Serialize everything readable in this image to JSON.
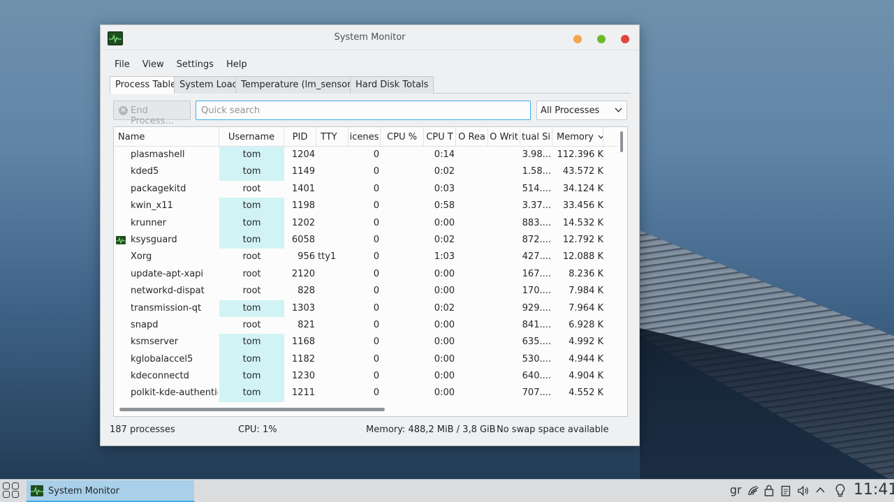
{
  "window": {
    "title": "System Monitor",
    "icon": "system-monitor-icon"
  },
  "menu": [
    "File",
    "View",
    "Settings",
    "Help"
  ],
  "tabs": [
    "Process Table",
    "System Load",
    "Temperature (lm_sensors)",
    "Hard Disk Totals"
  ],
  "active_tab": "Process Table",
  "toolbar": {
    "end_process_label": "End Process...",
    "search_placeholder": "Quick search",
    "filter_value": "All Processes"
  },
  "table": {
    "columns": [
      "Name",
      "Username",
      "PID",
      "TTY",
      "icenes",
      "CPU %",
      "CPU T",
      "O Rea",
      "O Writ",
      "tual Si",
      "Memory"
    ],
    "sort_column": "Memory",
    "rows": [
      {
        "name": "plasmashell",
        "user": "tom",
        "pid": "1204",
        "tty": "",
        "nice": "0",
        "cpu_time": "0:14",
        "virtual": "3.98...",
        "memory": "112.396 K"
      },
      {
        "name": "kded5",
        "user": "tom",
        "pid": "1149",
        "tty": "",
        "nice": "0",
        "cpu_time": "0:02",
        "virtual": "1.58...",
        "memory": "43.572 K"
      },
      {
        "name": "packagekitd",
        "user": "root",
        "pid": "1401",
        "tty": "",
        "nice": "0",
        "cpu_time": "0:03",
        "virtual": "514....",
        "memory": "34.124 K"
      },
      {
        "name": "kwin_x11",
        "user": "tom",
        "pid": "1198",
        "tty": "",
        "nice": "0",
        "cpu_time": "0:58",
        "virtual": "3.37...",
        "memory": "33.456 K"
      },
      {
        "name": "krunner",
        "user": "tom",
        "pid": "1202",
        "tty": "",
        "nice": "0",
        "cpu_time": "0:00",
        "virtual": "883....",
        "memory": "14.532 K"
      },
      {
        "name": "ksysguard",
        "user": "tom",
        "pid": "6058",
        "tty": "",
        "nice": "0",
        "cpu_time": "0:02",
        "virtual": "872....",
        "memory": "12.792 K",
        "icon": true
      },
      {
        "name": "Xorg",
        "user": "root",
        "pid": "956",
        "tty": "tty1",
        "nice": "0",
        "cpu_time": "1:03",
        "virtual": "427....",
        "memory": "12.088 K"
      },
      {
        "name": "update-apt-xapi",
        "user": "root",
        "pid": "2120",
        "tty": "",
        "nice": "0",
        "cpu_time": "0:00",
        "virtual": "167....",
        "memory": "8.236 K"
      },
      {
        "name": "networkd-dispat",
        "user": "root",
        "pid": "828",
        "tty": "",
        "nice": "0",
        "cpu_time": "0:00",
        "virtual": "170....",
        "memory": "7.984 K"
      },
      {
        "name": "transmission-qt",
        "user": "tom",
        "pid": "1303",
        "tty": "",
        "nice": "0",
        "cpu_time": "0:02",
        "virtual": "929....",
        "memory": "7.964 K"
      },
      {
        "name": "snapd",
        "user": "root",
        "pid": "821",
        "tty": "",
        "nice": "0",
        "cpu_time": "0:00",
        "virtual": "841....",
        "memory": "6.928 K"
      },
      {
        "name": "ksmserver",
        "user": "tom",
        "pid": "1168",
        "tty": "",
        "nice": "0",
        "cpu_time": "0:00",
        "virtual": "635....",
        "memory": "4.992 K"
      },
      {
        "name": "kglobalaccel5",
        "user": "tom",
        "pid": "1182",
        "tty": "",
        "nice": "0",
        "cpu_time": "0:00",
        "virtual": "530....",
        "memory": "4.944 K"
      },
      {
        "name": "kdeconnectd",
        "user": "tom",
        "pid": "1230",
        "tty": "",
        "nice": "0",
        "cpu_time": "0:00",
        "virtual": "640....",
        "memory": "4.904 K"
      },
      {
        "name": "polkit-kde-authentic...",
        "user": "tom",
        "pid": "1211",
        "tty": "",
        "nice": "0",
        "cpu_time": "0:00",
        "virtual": "707....",
        "memory": "4.552 K"
      }
    ]
  },
  "status": {
    "processes": "187 processes",
    "cpu": "CPU: 1%",
    "memory": "Memory: 488,2 MiB / 3,8 GiB",
    "swap": "No swap space available"
  },
  "taskbar": {
    "task_label": "System Monitor",
    "keyboard_layout": "gr",
    "clock": "11:41"
  },
  "colors": {
    "user_highlight": "#d2f3f5",
    "accent": "#3daee9"
  }
}
